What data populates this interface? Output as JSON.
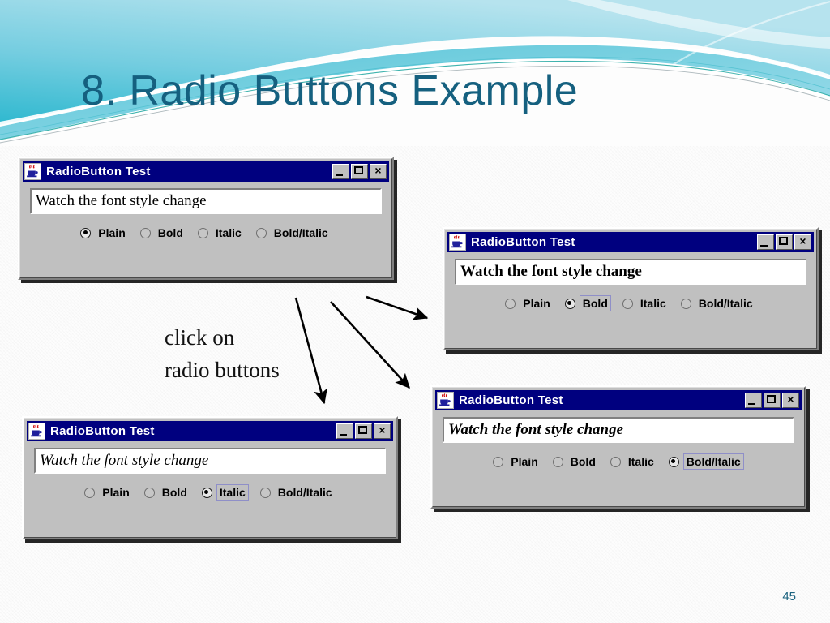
{
  "slide": {
    "title": "8.  Radio Buttons Example",
    "title_color": "#15607f",
    "page_number": "45",
    "background_color": "#fdfdfd"
  },
  "banner": {
    "accent_color": "#56c4d8",
    "gradient_from": "#3bb8cc",
    "gradient_to": "#b9e4ee"
  },
  "annotation": {
    "line1": "click on",
    "line2": "radio buttons"
  },
  "windows": [
    {
      "id": "window-plain",
      "title": "RadioButton Test",
      "icon": "java-coffee-cup-icon",
      "textfield_value": "Watch the font style change",
      "textfield_style": "st-plain",
      "selected": "Plain",
      "focused": "",
      "buttons": {
        "minimize": "_",
        "maximize": "□",
        "close": "×"
      },
      "radios": [
        "Plain",
        "Bold",
        "Italic",
        "Bold/Italic"
      ]
    },
    {
      "id": "window-bold",
      "title": "RadioButton Test",
      "icon": "java-coffee-cup-icon",
      "textfield_value": "Watch the font style change",
      "textfield_style": "st-bold",
      "selected": "Bold",
      "focused": "Bold",
      "buttons": {
        "minimize": "_",
        "maximize": "□",
        "close": "×"
      },
      "radios": [
        "Plain",
        "Bold",
        "Italic",
        "Bold/Italic"
      ]
    },
    {
      "id": "window-italic",
      "title": "RadioButton Test",
      "icon": "java-coffee-cup-icon",
      "textfield_value": "Watch the font style change",
      "textfield_style": "st-italic",
      "selected": "Italic",
      "focused": "Italic",
      "buttons": {
        "minimize": "_",
        "maximize": "□",
        "close": "×"
      },
      "radios": [
        "Plain",
        "Bold",
        "Italic",
        "Bold/Italic"
      ]
    },
    {
      "id": "window-bolditalic",
      "title": "RadioButton Test",
      "icon": "java-coffee-cup-icon",
      "textfield_value": "Watch the font style change",
      "textfield_style": "st-bolditalic",
      "selected": "Bold/Italic",
      "focused": "Bold/Italic",
      "buttons": {
        "minimize": "_",
        "maximize": "□",
        "close": "×"
      },
      "radios": [
        "Plain",
        "Bold",
        "Italic",
        "Bold/Italic"
      ]
    }
  ]
}
